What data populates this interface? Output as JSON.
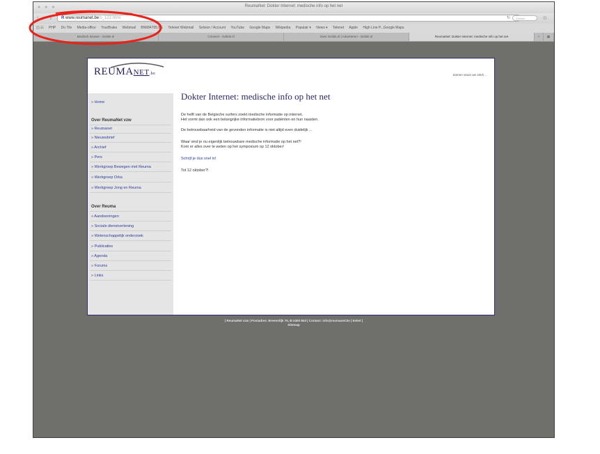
{
  "browser": {
    "window_title": "ReumaNet: Dokter Internet: medische info op het net",
    "url_main": "www.reumanet.be",
    "url_rest": "/s_122.html",
    "search_placeholder": "Zoeken",
    "reader_icon": "reload-icon",
    "bookmarks": [
      "PHP",
      "Do Tile",
      "Media-office",
      "YourBrake",
      "Webmail",
      "BN684705.BE",
      "Telenet Webmail",
      "Selsion / Account",
      "YouTube",
      "Google Maps",
      "Wikipedia",
      "Populair ▾",
      "News ▾",
      "Telenet",
      "Apple",
      "High Line P...Google Maps"
    ],
    "tabs": [
      "Medisch nieuws - Gelink.nl",
      "Connect - Gelink.nl",
      "Over Gelink.nl | Adverteren - Gelink.nl",
      "ReumaNet: Dokter Internet: medische info op het net"
    ],
    "tab_add": "+",
    "tab_overview": "▦"
  },
  "site": {
    "logo_main": "REUMA",
    "logo_net": "NET",
    "logo_tld": ".be",
    "tagline": "Samen staan we sterk ..."
  },
  "sidebar": {
    "home": "» Home",
    "section1_heading": "Over ReumaNet vzw",
    "section1_items": [
      "» Reumanet",
      "» Nieuwsbrief",
      "» Archief",
      "» Pers",
      "» Werkgroep Bewegen met Reuma",
      "» Werkgroep Orka",
      "» Werkgroep Jong en Reuma"
    ],
    "section2_heading": "Over Reuma",
    "section2_items": [
      "» Aandoeningen",
      "» Sociale dienstverlening",
      "» Wetenschappelijk onderzoek",
      "» Publicaties",
      "» Agenda",
      "» Forums",
      "» Links"
    ]
  },
  "content": {
    "title": "Dokter Internet: medische info op het net",
    "para1_line1": "De helft van de Belgische surfers zoekt medische informatie op internet.",
    "para1_line2": "Het vormt dan ook een belangrijke informatiebron voor patiënten en hun naasten.",
    "para2": "De betrouwbaarheid van de gevonden informatie is niet altijd even duidelijk ...",
    "para3_line1": "Waar vind je nu eigenlijk betrouwbare medische informatie op het net?!",
    "para3_line2": "Kom er alles over te weten op het symposium op 12 oktober!",
    "signup_link": "Schrijf je dus snel in!",
    "closing": "Tot 12 oktober?!"
  },
  "footer": {
    "line1": "| ReumaNet vzw | Postadres: Breeerdijk 75, B-2400 Mol | Contact: info@reumanet.be | Enkel |",
    "line2": "Sitemap"
  },
  "colors": {
    "annotation": "#e8231a",
    "link": "#2d3c9c",
    "heading": "#27296e",
    "background_gray": "#6f6f6b"
  }
}
